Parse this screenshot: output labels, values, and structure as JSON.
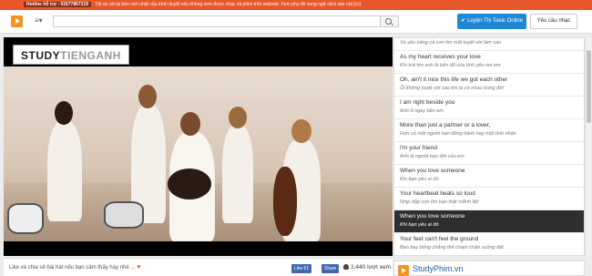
{
  "topbar": {
    "hotline": "Hotline hỗ trợ : 01677867319",
    "notice": "Tải và cài lại bản mới nhất của trình duyệt nếu không xem được nhạc và phim trên website. Xem phụ đề song ngữ click vào nút [cc]"
  },
  "header": {
    "logo_icon": "play-icon",
    "menu_label": "≡▾",
    "search_placeholder": "",
    "toeic_button": "Luyện Thi Toeic Online",
    "request_button": "Yêu cầu nhạc"
  },
  "player": {
    "watermark_bold": "STUDY",
    "watermark_light": "TIENGANH"
  },
  "lyrics": [
    {
      "en": "",
      "vi": "Và yêu bằng cả con tim một tuyệt vời làm sao"
    },
    {
      "en": "As my heart receives your love",
      "vi": "Khi trái tim anh là bến đỗ của tình yêu nơi em"
    },
    {
      "en": "Oh, ain't it nice this life we got each other",
      "vi": "Ôi không tuyệt vời sao khi ta có nhau trong đời"
    },
    {
      "en": "I am right beside you",
      "vi": "Anh ở ngay bên em"
    },
    {
      "en": "More than just a partner or a lover,",
      "vi": "Hơn cả một người bạn đồng hành hay một tình nhân"
    },
    {
      "en": "I'm your friend",
      "vi": "Anh là người bạn đời của em"
    },
    {
      "en": "When you love someone",
      "vi": "Khi bạn yêu ai đó"
    },
    {
      "en": "Your heartbeat beats so loud",
      "vi": "Nhịp đập con tim bạn thật mãnh liệt"
    },
    {
      "en": "When you love someone",
      "vi": "Khi bạn yêu ai đó"
    },
    {
      "en": "Your feet can't feel the ground",
      "vi": "Bạn bay bổng chẳng thể chạm chân xuống đất"
    }
  ],
  "active_lyric_index": 8,
  "footer": {
    "share_text": "Like và chia sẻ bài hát nếu bạn cảm thấy hay nhé ...",
    "heart": "♥",
    "fb_like": "Like 61",
    "fb_share": "Share",
    "views": "2,440 lượt xem"
  },
  "ad": {
    "text": "StudyPhim.vn"
  },
  "colors": {
    "topbar": "#e8572a",
    "accent_blue": "#1e88d6",
    "active_lyric_bg": "#2e2e2e"
  }
}
